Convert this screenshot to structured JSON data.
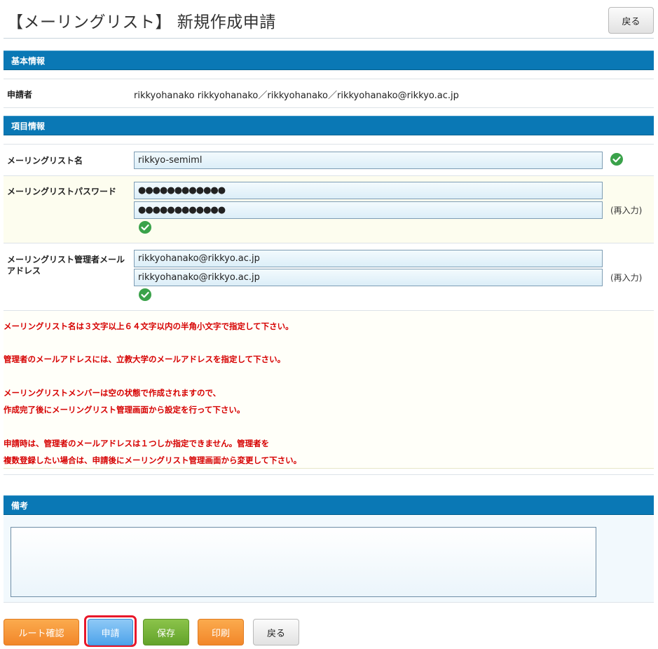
{
  "page": {
    "title": "【メーリングリスト】 新規作成申請",
    "back_top_label": "戻る"
  },
  "basic_info": {
    "header": "基本情報",
    "applicant_label": "申請者",
    "applicant_value": "rikkyohanako  rikkyohanako／rikkyohanako／rikkyohanako@rikkyo.ac.jp"
  },
  "item_info": {
    "header": "項目情報",
    "ml_name_label": "メーリングリスト名",
    "ml_name_value": "rikkyo-semiml",
    "password_label": "メーリングリストパスワード",
    "password_value": "●●●●●●●●●●●●",
    "password_confirm_value": "●●●●●●●●●●●●",
    "reenter_label": "(再入力)",
    "admin_email_label_line1": "メーリングリスト管理者メール",
    "admin_email_label_line2": "アドレス",
    "admin_email_value": "rikkyohanako@rikkyo.ac.jp",
    "admin_email_confirm_value": "rikkyohanako@rikkyo.ac.jp"
  },
  "notices": [
    "メーリングリスト名は３文字以上６４文字以内の半角小文字で指定して下さい。",
    "管理者のメールアドレスには、立教大学のメールアドレスを指定して下さい。",
    "メーリングリストメンバーは空の状態で作成されますので、",
    "作成完了後にメーリングリスト管理画面から設定を行って下さい。",
    "申請時は、管理者のメールアドレスは１つしか指定できません。管理者を",
    "複数登録したい場合は、申請後にメーリングリスト管理画面から変更して下さい。"
  ],
  "remarks": {
    "header": "備考",
    "value": ""
  },
  "actions": {
    "route_confirm": "ルート確認",
    "apply": "申請",
    "save": "保存",
    "print": "印刷",
    "back": "戻る"
  },
  "colors": {
    "section_header": "#0a78b5",
    "notice_text": "#d60000",
    "check_green": "#3aa24a",
    "highlight_border": "#e8172a"
  }
}
